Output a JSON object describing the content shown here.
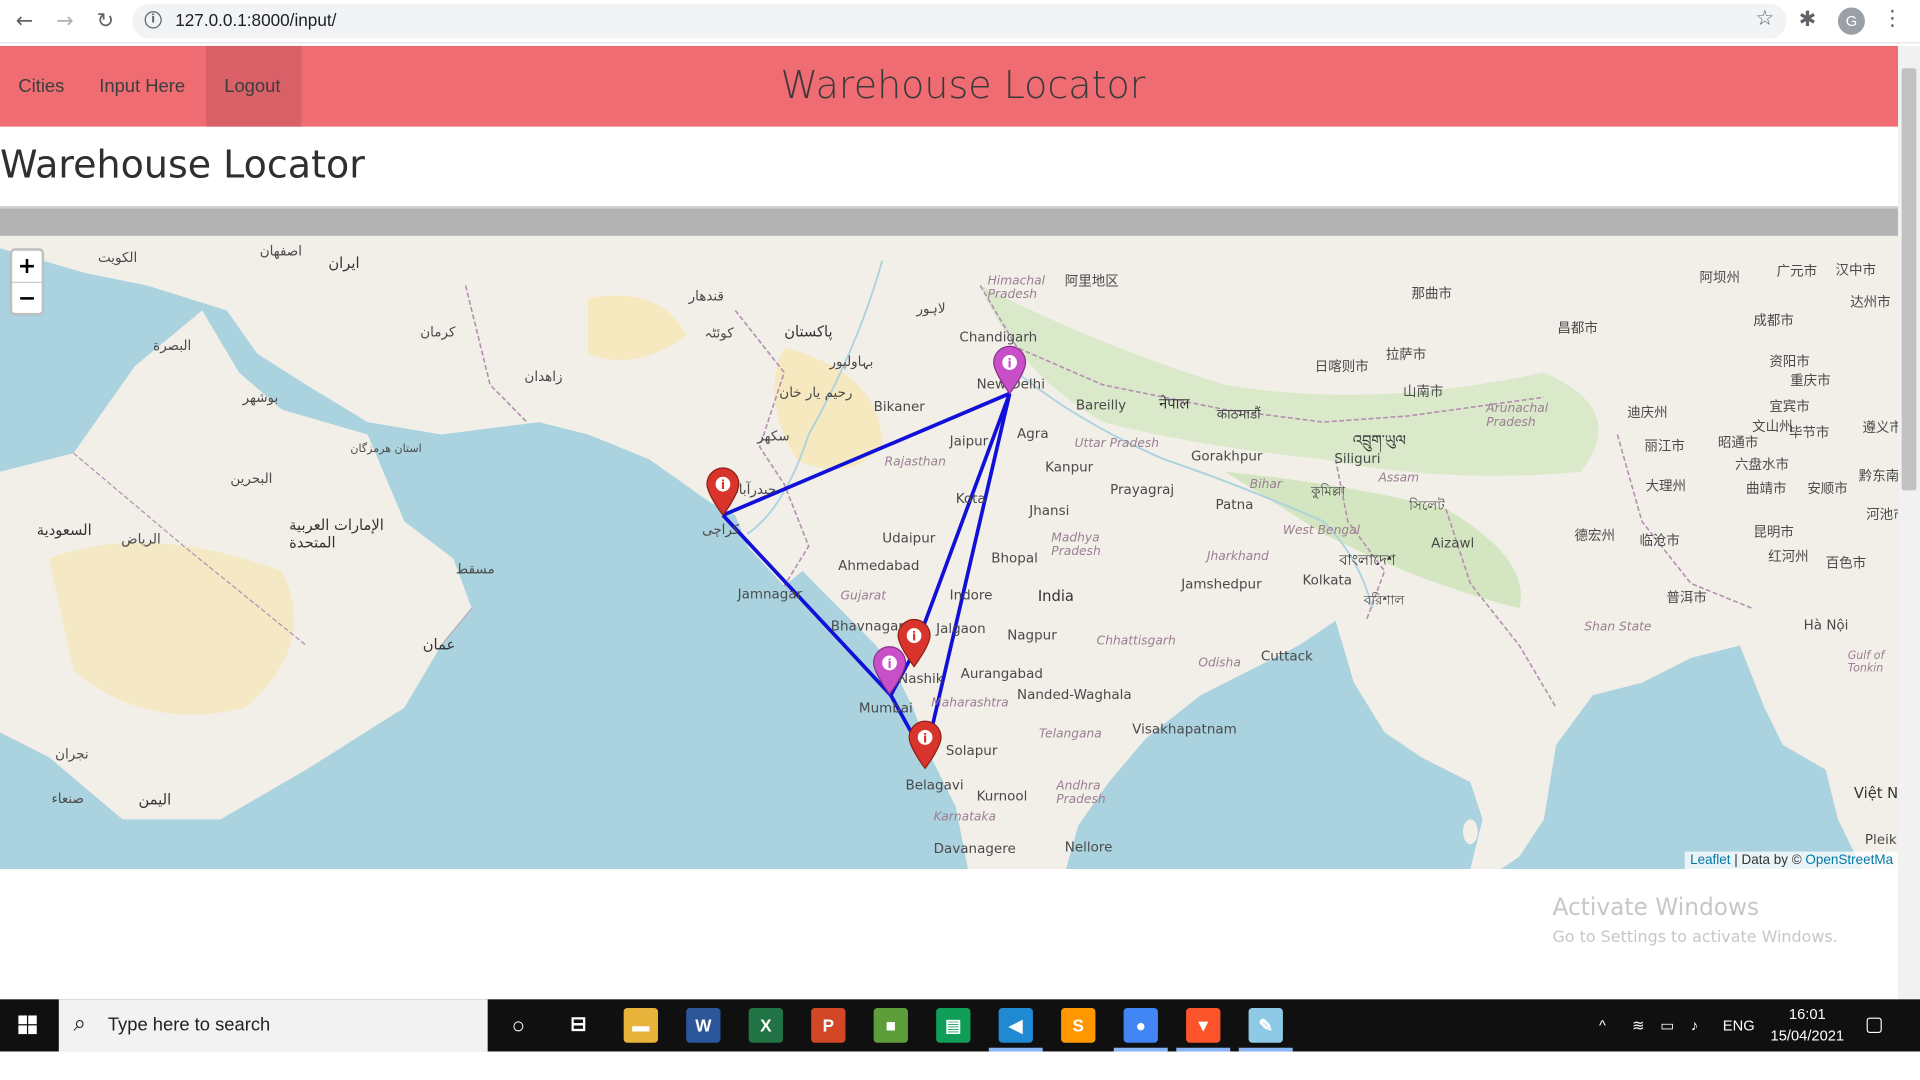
{
  "browser": {
    "url": "127.0.0.1:8000/input/",
    "profile_initial": "G"
  },
  "navbar": {
    "links": [
      "Cities",
      "Input Here",
      "Logout"
    ],
    "title": "Warehouse Locator"
  },
  "page": {
    "heading": "Warehouse Locator"
  },
  "map": {
    "zoom_in": "+",
    "zoom_out": "−",
    "attribution_leaflet": "Leaflet",
    "attribution_sep": " | Data by © ",
    "attribution_osm": "OpenStreetMa",
    "route_color": "#1010d8",
    "marker_colors": {
      "warehouse": "#d9342b",
      "hub": "#c94fc9"
    },
    "labels": {
      "newdelhi": "New Delhi",
      "chandigarh": "Chandigarh",
      "bikaner": "Bikaner",
      "jaipur": "Jaipur",
      "agra": "Agra",
      "kanpur": "Kanpur",
      "bareilly": "Bareilly",
      "prayagraj": "Prayagraj",
      "gorakhpur": "Gorakhpur",
      "patna": "Patna",
      "siliguri": "Siliguri",
      "jhansi": "Jhansi",
      "kota": "Kota",
      "udaipur": "Udaipur",
      "ahmedabad": "Ahmedabad",
      "jamnagar": "Jamnagar",
      "bhavnagar": "Bhavnagar",
      "bhopal": "Bhopal",
      "indore": "Indore",
      "india": "India",
      "jalgaon": "Jalgaon",
      "nagpur": "Nagpur",
      "nashik": "Nashik",
      "aurangabad": "Aurangabad",
      "nanded": "Nanded-Waghala",
      "mumbai": "Mumbai",
      "solapur": "Solapur",
      "belagavi": "Belagavi",
      "kurnool": "Kurnool",
      "davanagere": "Davanagere",
      "nellore": "Nellore",
      "visakhapatnam": "Visakhapatnam",
      "cuttack": "Cuttack",
      "kolkata": "Kolkata",
      "jamshedpur": "Jamshedpur",
      "aizawl": "Aizawl",
      "hanoi": "Hà Nội",
      "rajasthan": "Rajasthan",
      "gujarat": "Gujarat",
      "madhya_pradesh": "Madhya Pradesh",
      "uttar_pradesh": "Uttar Pradesh",
      "maharashtra": "Maharashtra",
      "chhattisgarh": "Chhattisgarh",
      "telangana": "Telangana",
      "andhra_pradesh": "Andhra Pradesh",
      "karnataka": "Karnataka",
      "odisha": "Odisha",
      "jharkhand": "Jharkhand",
      "bihar": "Bihar",
      "west_bengal": "West Bengal",
      "assam": "Assam",
      "himachal_pradesh": "Himachal Pradesh",
      "arunachal_pradesh": "Arunachal Pradesh",
      "shan_state": "Shan State",
      "gulf_of_tonkin": "Gulf of Tonkin",
      "viet_nam": "Việt N",
      "pleik": "Pleik",
      "lahore": "لاہور",
      "karachi": "کراچی",
      "hyderabad_pk": "حیدرآباد",
      "sukkur": "سکھر",
      "pakistan": "پاکستان",
      "quetta": "کوئٹہ",
      "kandahar": "قندهار",
      "bahawalpur": "بہاولپور",
      "rahim_yar_khan": "رحیم یار خان",
      "zahedan": "زاهدان",
      "kerman": "کرمان",
      "iran": "ایران",
      "isfahan": "اصفهان",
      "kuwait": "الكويت",
      "basra": "البصرة",
      "bushehr": "بوشهر",
      "bandar_abbas": "استان هرمزگان",
      "oman": "عمان",
      "muscat": "مسقط",
      "uae": "الإمارات العربية المتحدة",
      "riyadh": "الرياض",
      "saudi": "السعودية",
      "yemen": "اليمن",
      "bahrain": "البحرين",
      "sanaa": "صنعاء",
      "najran": "نجران",
      "lhasa": "拉萨市",
      "shigatse": "日喀则市",
      "shannan": "山南市",
      "nagqu": "那曲市",
      "ngari": "阿里地区",
      "chengdu": "成都市",
      "chongqing": "重庆市",
      "kunming": "昆明市",
      "dali": "大理州",
      "lijiang": "丽江市",
      "lincang": "临沧市",
      "puer": "普洱市",
      "honghe": "红河州",
      "baise": "百色市",
      "changdu": "昌都市",
      "aba": "阿坝州",
      "guangyuan": "广元市",
      "dazhou": "达州市",
      "ziyang": "资阳市",
      "yibin": "宜宾市",
      "bijie": "毕节市",
      "zhaotong": "昭通市",
      "liupanshui": "六盘水市",
      "qujing": "曲靖市",
      "anshun": "安顺市",
      "dehong": "德宏州",
      "qiandongnan": "黔东南州",
      "zunyi": "遵义市",
      "hechi": "河池市",
      "wenshan": "文山州",
      "diqing": "迪庆州",
      "hanzhong": "汉中市",
      "kathmandu": "काठमाडौं",
      "nepal": "नेपाल",
      "bhutan": "འབྲུག་ཡུལ",
      "bangladesh": "বাংলাদেশ",
      "sylhet": "সিলেট",
      "barisal": "বরিশাল",
      "dhaka": "কুমিল্লা"
    }
  },
  "watermark": {
    "title": "Activate Windows",
    "subtitle": "Go to Settings to activate Windows."
  },
  "taskbar": {
    "search_placeholder": "Type here to search",
    "language": "ENG",
    "time": "16:01",
    "date": "15/04/2021",
    "apps": [
      {
        "name": "file-explorer",
        "glyph": "▬",
        "color": "#e8b33a"
      },
      {
        "name": "word",
        "glyph": "W",
        "color": "#2b579a"
      },
      {
        "name": "excel",
        "glyph": "X",
        "color": "#217346"
      },
      {
        "name": "powerpoint",
        "glyph": "P",
        "color": "#d24726"
      },
      {
        "name": "store",
        "glyph": "■",
        "color": "#5e9e3a"
      },
      {
        "name": "sheets",
        "glyph": "▤",
        "color": "#0f9d58"
      },
      {
        "name": "vscode",
        "glyph": "◀",
        "color": "#1f8ad2"
      },
      {
        "name": "sublime",
        "glyph": "S",
        "color": "#ff9800"
      },
      {
        "name": "chrome",
        "glyph": "●",
        "color": "#4285f4"
      },
      {
        "name": "brave",
        "glyph": "▼",
        "color": "#fb542b"
      },
      {
        "name": "paint",
        "glyph": "✎",
        "color": "#8ecae6"
      }
    ]
  }
}
